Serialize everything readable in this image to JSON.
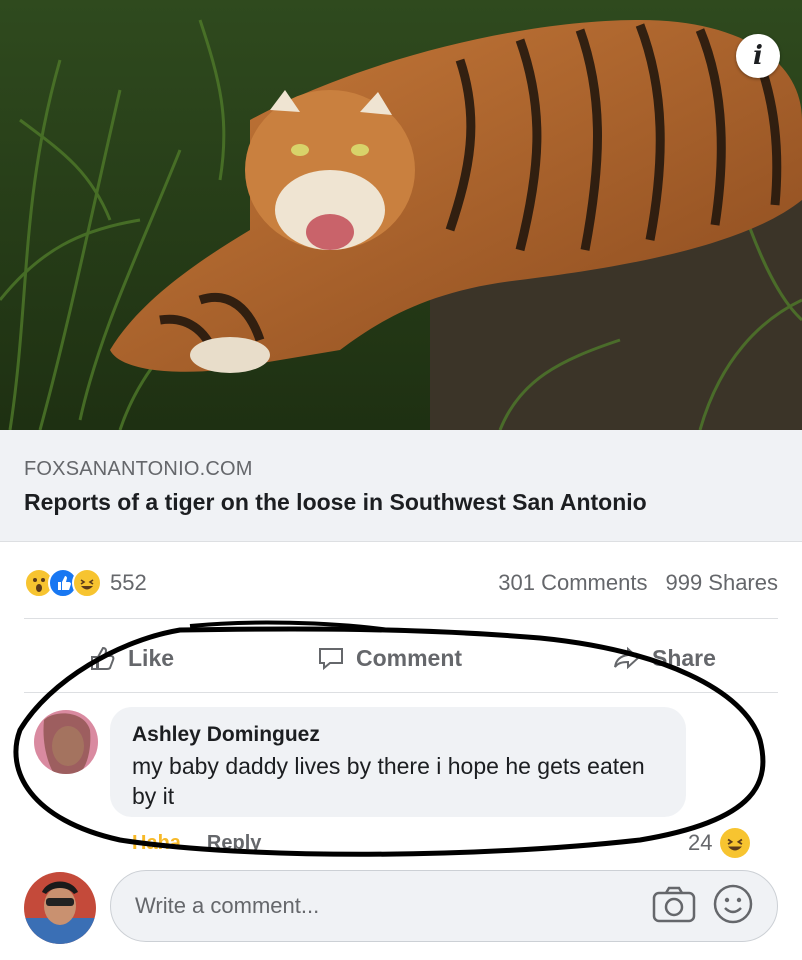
{
  "post": {
    "link": {
      "domain": "FOXSANANTONIO.COM",
      "title": "Reports of a tiger on the loose in Southwest San Antonio"
    },
    "reactions": {
      "icons": [
        "wow-icon",
        "like-icon",
        "haha-icon"
      ],
      "count": "552"
    },
    "comments_count": "301 Comments",
    "shares_count": "999 Shares"
  },
  "actions": {
    "like": "Like",
    "comment": "Comment",
    "share": "Share"
  },
  "comment": {
    "author": "Ashley Dominguez",
    "text": "my baby daddy lives by there i hope he gets eaten by it",
    "meta": {
      "haha": "Haha",
      "reply": "Reply"
    },
    "reaction_count": "24"
  },
  "composer": {
    "placeholder": "Write a comment..."
  },
  "colors": {
    "accent": "#1877f2",
    "muted": "#65676b",
    "bubble": "#f0f2f5"
  }
}
